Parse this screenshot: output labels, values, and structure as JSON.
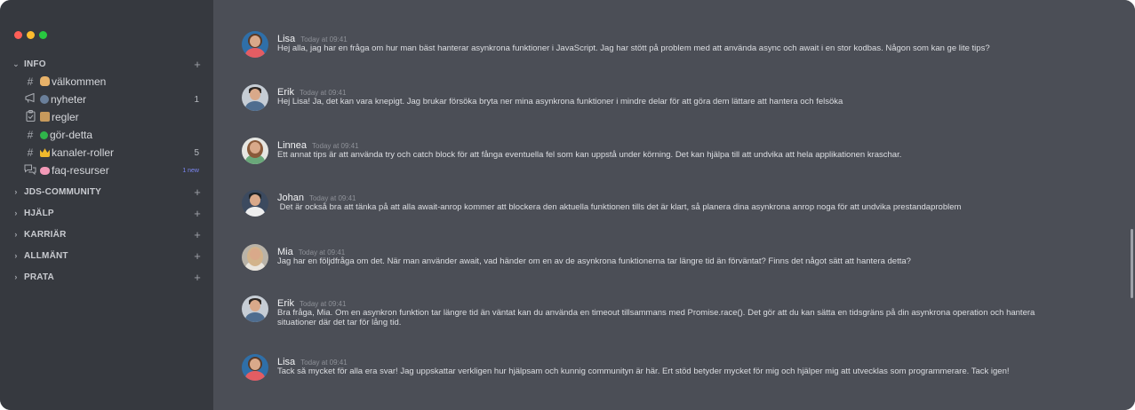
{
  "window": {
    "buttons": [
      "close",
      "minimize",
      "zoom"
    ]
  },
  "sidebar": {
    "categories": [
      {
        "label": "INFO",
        "expanded": true,
        "channels": [
          {
            "icon": "#",
            "emoji": "waving-hand",
            "label": "välkommen",
            "count": ""
          },
          {
            "icon": "megaphone",
            "emoji": "runner",
            "label": "nyheter",
            "count": "1"
          },
          {
            "icon": "clipboard",
            "emoji": "scroll",
            "label": "regler",
            "count": ""
          },
          {
            "icon": "#",
            "emoji": "green-circle",
            "label": "gör-detta",
            "count": ""
          },
          {
            "icon": "#",
            "emoji": "crown",
            "label": "kanaler-roller",
            "count": "5"
          },
          {
            "icon": "speech-bubbles",
            "emoji": "brain",
            "label": "faq-resurser",
            "badge": "1 new"
          }
        ]
      },
      {
        "label": "JDS-COMMUNITY",
        "expanded": false
      },
      {
        "label": "HJÄLP",
        "expanded": false
      },
      {
        "label": "KARRIÄR",
        "expanded": false
      },
      {
        "label": "ALLMÄNT",
        "expanded": false
      },
      {
        "label": "PRATA",
        "expanded": false
      }
    ]
  },
  "messages": [
    {
      "author": "Lisa",
      "time": "Today at 09:41",
      "avatar": "lisa",
      "text": "Hej alla, jag har en fråga om hur man bäst hanterar asynkrona funktioner i JavaScript. Jag har stött på problem med att använda async och await i en stor kodbas. Någon som kan ge lite tips?"
    },
    {
      "author": "Erik",
      "time": "Today at 09:41",
      "avatar": "erik",
      "text": "Hej Lisa! Ja, det kan vara knepigt. Jag brukar försöka bryta ner mina asynkrona funktioner i mindre delar för att göra dem lättare att hantera och felsöka"
    },
    {
      "author": "Linnea",
      "time": "Today at 09:41",
      "avatar": "linnea",
      "text": "Ett annat tips är att använda try och catch block för att fånga eventuella fel som kan uppstå under körning. Det kan hjälpa till att undvika att hela applikationen kraschar."
    },
    {
      "author": "Johan",
      "time": "Today at 09:41",
      "avatar": "johan",
      "text": " Det är också bra att tänka på att alla await-anrop kommer att blockera den aktuella funktionen tills det är klart, så planera dina asynkrona anrop noga för att undvika prestandaproblem"
    },
    {
      "author": "Mia",
      "time": "Today at 09:41",
      "avatar": "mia",
      "text": "Jag har en följdfråga om det. När man använder await, vad händer om en av de asynkrona funktionerna tar längre tid än förväntat? Finns det något sätt att hantera detta?"
    },
    {
      "author": "Erik",
      "time": "Today at 09:41",
      "avatar": "erik",
      "text": "Bra fråga, Mia. Om en asynkron funktion tar längre tid än väntat kan du använda en timeout tillsammans med Promise.race(). Det gör att du kan sätta en tidsgräns på din asynkrona operation och hantera\nsituationer där det tar för lång tid."
    },
    {
      "author": "Lisa",
      "time": "Today at 09:41",
      "avatar": "lisa",
      "text": "Tack så mycket för alla era svar! Jag uppskattar verkligen hur hjälpsam och kunnig communityn är här. Ert stöd betyder mycket för mig och hjälper mig att utvecklas som programmerare. Tack igen!"
    }
  ],
  "colors": {
    "sidebar_bg": "#36393f",
    "chat_bg": "#4b4e56",
    "new_badge": "#7b86f2"
  }
}
